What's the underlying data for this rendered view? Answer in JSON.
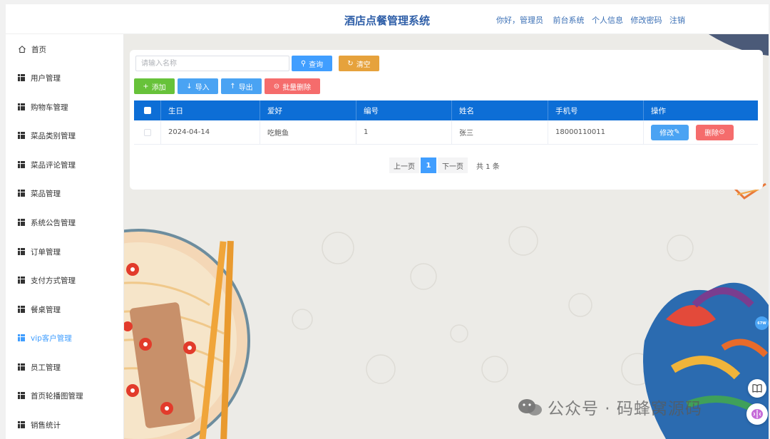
{
  "header": {
    "title": "酒店点餐管理系统",
    "greeting": "你好，管理员",
    "links": [
      "前台系统",
      "个人信息",
      "修改密码",
      "注销"
    ]
  },
  "sidebar": {
    "items": [
      {
        "label": "首页",
        "icon": "home-icon",
        "active": false
      },
      {
        "label": "用户管理",
        "icon": "grid-icon",
        "active": false
      },
      {
        "label": "购物车管理",
        "icon": "grid-icon",
        "active": false
      },
      {
        "label": "菜品类别管理",
        "icon": "grid-icon",
        "active": false
      },
      {
        "label": "菜品评论管理",
        "icon": "grid-icon",
        "active": false
      },
      {
        "label": "菜品管理",
        "icon": "grid-icon",
        "active": false
      },
      {
        "label": "系统公告管理",
        "icon": "grid-icon",
        "active": false
      },
      {
        "label": "订单管理",
        "icon": "grid-icon",
        "active": false
      },
      {
        "label": "支付方式管理",
        "icon": "grid-icon",
        "active": false
      },
      {
        "label": "餐桌管理",
        "icon": "grid-icon",
        "active": false
      },
      {
        "label": "vip客户管理",
        "icon": "grid-icon",
        "active": true
      },
      {
        "label": "员工管理",
        "icon": "grid-icon",
        "active": false
      },
      {
        "label": "首页轮播图管理",
        "icon": "grid-icon",
        "active": false
      },
      {
        "label": "销售统计",
        "icon": "grid-icon",
        "active": false
      }
    ]
  },
  "search": {
    "placeholder": "请输入名称",
    "value": "",
    "query_label": "查询",
    "clear_label": "清空"
  },
  "toolbar": {
    "add_label": "添加",
    "import_label": "导入",
    "export_label": "导出",
    "batch_delete_label": "批量删除"
  },
  "table": {
    "columns": [
      "生日",
      "爱好",
      "编号",
      "姓名",
      "手机号",
      "操作"
    ],
    "rows": [
      {
        "birthday": "2024-04-14",
        "hobby": "吃鲍鱼",
        "number": "1",
        "name": "张三",
        "phone": "18000110011"
      }
    ],
    "edit_label": "修改",
    "delete_label": "删除"
  },
  "pagination": {
    "prev_label": "上一页",
    "current_page": "1",
    "next_label": "下一页",
    "total_text": "共 1 条"
  },
  "overlay": {
    "watermark": "公众号 · 码蜂窝源码",
    "badge": "67W"
  },
  "colors": {
    "accent": "#409eff",
    "title": "#2f5fa8",
    "table_header": "#0d6ed6",
    "danger": "#f56c6c",
    "success": "#67c23a",
    "warning": "#e6a23c"
  }
}
